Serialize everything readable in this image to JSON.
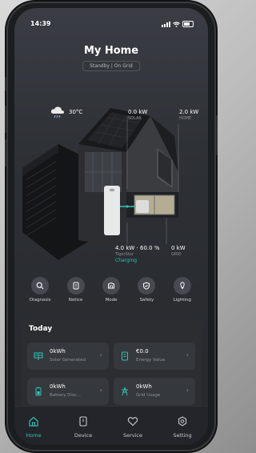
{
  "status_bar": {
    "time": "14:39"
  },
  "header": {
    "title": "My Home",
    "mode": "Standby  |  On Grid"
  },
  "weather": {
    "temperature": "30°C"
  },
  "energy_flow": {
    "solar": {
      "value": "0.0 kW",
      "label": "SOLAR"
    },
    "home": {
      "value": "2.0 kW",
      "label": "HOME"
    },
    "battery": {
      "value": "4.0 kW · 60.0 %",
      "label": "TigerStor",
      "state": "Charging"
    },
    "grid": {
      "value": "0 kW",
      "label": "GRID"
    }
  },
  "shortcuts": [
    {
      "label": "Diagnosis",
      "icon": "diagnosis-icon"
    },
    {
      "label": "Notice",
      "icon": "notice-icon"
    },
    {
      "label": "Mode",
      "icon": "mode-icon"
    },
    {
      "label": "Safety",
      "icon": "safety-icon"
    },
    {
      "label": "Lighting",
      "icon": "lighting-icon"
    }
  ],
  "today": {
    "title": "Today",
    "cards": [
      {
        "value": "0kWh",
        "label": "Solar Generated",
        "icon": "solar-panel-icon"
      },
      {
        "value": "€0.0",
        "label": "Energy Value",
        "icon": "wallet-icon"
      },
      {
        "value": "0kWh",
        "label": "Battery Disc...",
        "icon": "battery-icon"
      },
      {
        "value": "0kWh",
        "label": "Grid Usage",
        "icon": "grid-tower-icon"
      }
    ]
  },
  "tabbar": [
    {
      "label": "Home",
      "icon": "home-icon",
      "active": true
    },
    {
      "label": "Device",
      "icon": "device-icon",
      "active": false
    },
    {
      "label": "Service",
      "icon": "service-icon",
      "active": false
    },
    {
      "label": "Setting",
      "icon": "setting-icon",
      "active": false
    }
  ],
  "colors": {
    "accent": "#30c2b3",
    "background": "#2d3035",
    "card": "#35383d"
  }
}
